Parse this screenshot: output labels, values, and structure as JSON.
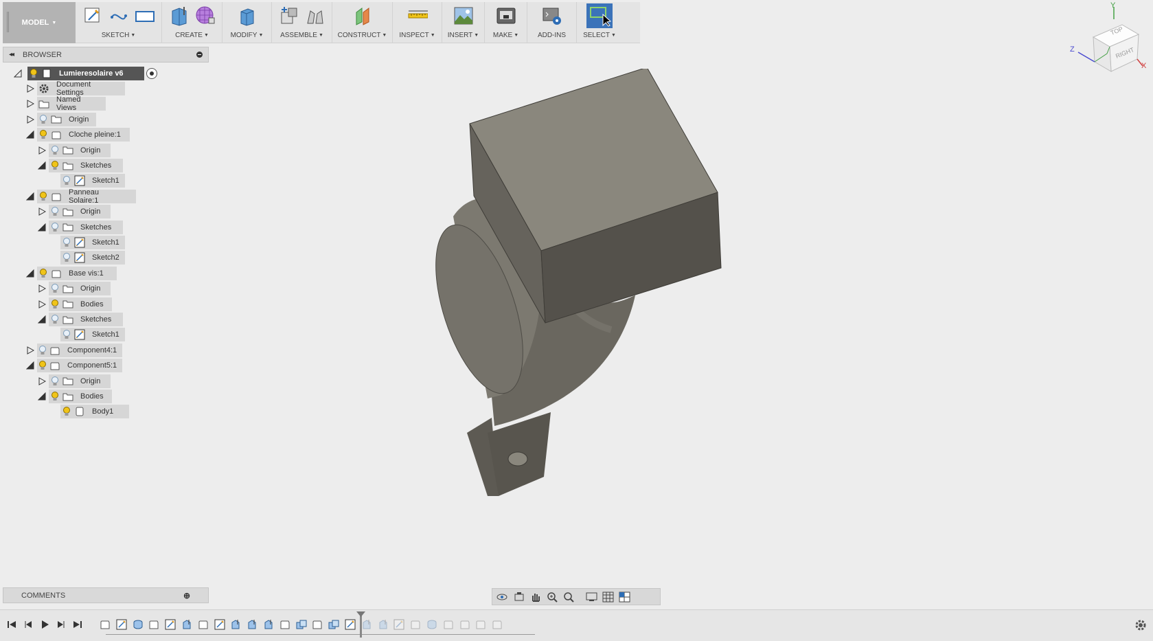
{
  "toolbar": {
    "mode": "MODEL",
    "groups": [
      {
        "label": "SKETCH"
      },
      {
        "label": "CREATE"
      },
      {
        "label": "MODIFY"
      },
      {
        "label": "ASSEMBLE"
      },
      {
        "label": "CONSTRUCT"
      },
      {
        "label": "INSPECT"
      },
      {
        "label": "INSERT"
      },
      {
        "label": "MAKE"
      },
      {
        "label": "ADD-INS"
      },
      {
        "label": "SELECT"
      }
    ]
  },
  "browser": {
    "title": "BROWSER",
    "items": [
      {
        "label": "Lumieresolaire v6",
        "icon": "document-icon"
      },
      {
        "label": "Document Settings",
        "icon": "gear-icon"
      },
      {
        "label": "Named Views",
        "icon": "folder-icon"
      },
      {
        "label": "Origin",
        "icon": "folder-icon"
      },
      {
        "label": "Cloche pleine:1",
        "icon": "component-icon"
      },
      {
        "label": "Origin",
        "icon": "folder-icon"
      },
      {
        "label": "Sketches",
        "icon": "folder-icon"
      },
      {
        "label": "Sketch1",
        "icon": "sketch-icon"
      },
      {
        "label": "Panneau Solaire:1",
        "icon": "component-icon"
      },
      {
        "label": "Origin",
        "icon": "folder-icon"
      },
      {
        "label": "Sketches",
        "icon": "folder-icon"
      },
      {
        "label": "Sketch1",
        "icon": "sketch-icon"
      },
      {
        "label": "Sketch2",
        "icon": "sketch-icon"
      },
      {
        "label": "Base vis:1",
        "icon": "component-icon"
      },
      {
        "label": "Origin",
        "icon": "folder-icon"
      },
      {
        "label": "Bodies",
        "icon": "folder-icon"
      },
      {
        "label": "Sketches",
        "icon": "folder-icon"
      },
      {
        "label": "Sketch1",
        "icon": "sketch-icon"
      },
      {
        "label": "Component4:1",
        "icon": "component-icon"
      },
      {
        "label": "Component5:1",
        "icon": "component-icon"
      },
      {
        "label": "Origin",
        "icon": "folder-icon"
      },
      {
        "label": "Bodies",
        "icon": "folder-icon"
      },
      {
        "label": "Body1",
        "icon": "body-icon"
      }
    ]
  },
  "comments": {
    "title": "COMMENTS"
  },
  "viewcube": {
    "top": "TOP",
    "right": "RIGHT",
    "x": "X",
    "y": "Y",
    "z": "Z"
  },
  "colors": {
    "accent": "#3b73b9",
    "bulb": "#f0c419",
    "root_bg": "#555555",
    "model_face": "#8a877d"
  }
}
